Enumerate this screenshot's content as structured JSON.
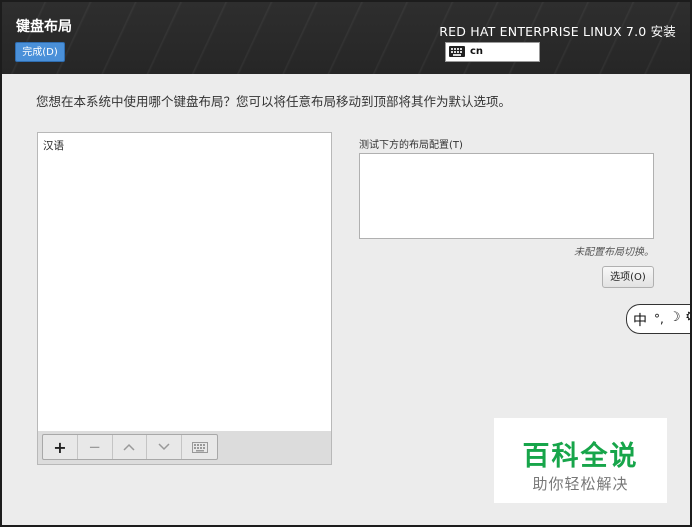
{
  "header": {
    "spoke_title": "键盘布局",
    "done_button": "完成(D)",
    "product_title": "RED HAT ENTERPRISE LINUX 7.0 安装",
    "layout_indicator": {
      "icon": "keyboard-icon",
      "code": "cn"
    }
  },
  "main": {
    "question": "您想在本系统中使用哪个键盘布局？您可以将任意布局移动到顶部将其作为默认选项。",
    "layouts": [
      "汉语"
    ],
    "toolbar": {
      "add": "+",
      "remove": "−",
      "move_up": "︿",
      "move_down": "﹀",
      "preview_icon": "keyboard-icon"
    },
    "test_label": "测试下方的布局配置(T)",
    "test_value": "",
    "switch_note": "未配置布局切换。",
    "options_button": "选项(O)"
  },
  "ime_bar": {
    "mode": "中",
    "punct": "°,",
    "moon": "☽",
    "gear": "⚙"
  },
  "watermark": {
    "title": "百科全说",
    "subtitle": "助你轻松解决"
  },
  "colors": {
    "accent": "#4a90d9",
    "header_bg": "#2a2a2a",
    "watermark_green": "#17a54a"
  }
}
